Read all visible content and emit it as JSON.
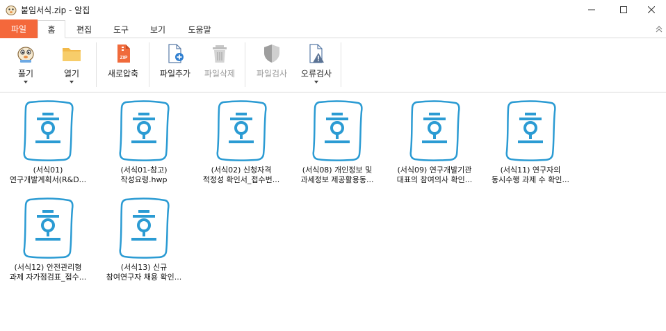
{
  "window": {
    "title": "붙임서식.zip - 알집",
    "app_icon": "alzip-mascot-icon",
    "controls": [
      "minimize-icon",
      "maximize-icon",
      "close-icon"
    ]
  },
  "menu": {
    "tabs": [
      "파일",
      "홈",
      "편집",
      "도구",
      "보기",
      "도움말"
    ],
    "active": "홈",
    "file_tab_color": "#f4683b"
  },
  "ribbon": {
    "buttons": [
      {
        "label": "풀기",
        "icon": "extract-mascot-icon",
        "has_dropdown": true,
        "enabled": true
      },
      {
        "label": "열기",
        "icon": "folder-icon",
        "has_dropdown": true,
        "enabled": true
      },
      {
        "label": "새로압축",
        "icon": "zip-file-icon",
        "has_dropdown": false,
        "enabled": true
      },
      {
        "label": "파일추가",
        "icon": "add-file-icon",
        "has_dropdown": false,
        "enabled": true
      },
      {
        "label": "파일삭제",
        "icon": "trash-icon",
        "has_dropdown": false,
        "enabled": false
      },
      {
        "label": "파일검사",
        "icon": "shield-icon",
        "has_dropdown": false,
        "enabled": false
      },
      {
        "label": "오류검사",
        "icon": "warning-file-icon",
        "has_dropdown": true,
        "enabled": true
      }
    ]
  },
  "files": [
    {
      "line1": "(서식01)",
      "line2": "연구개발계획서(R&D...",
      "icon": "hwp-document-icon"
    },
    {
      "line1": "(서식01-참고)",
      "line2": "작성요령.hwp",
      "icon": "hwp-document-icon"
    },
    {
      "line1": "(서식02) 신청자격",
      "line2": "적정성 확인서_접수번...",
      "icon": "hwp-document-icon"
    },
    {
      "line1": "(서식08) 개인정보 및",
      "line2": "과세정보 제공활용동...",
      "icon": "hwp-document-icon"
    },
    {
      "line1": "(서식09) 연구개발기관",
      "line2": "대표의 참여의사 확인...",
      "icon": "hwp-document-icon"
    },
    {
      "line1": "(서식11) 연구자의",
      "line2": "동시수행 과제 수 확인...",
      "icon": "hwp-document-icon"
    },
    {
      "line1": "(서식12) 안전관리형",
      "line2": "과제 자가점검표_접수...",
      "icon": "hwp-document-icon"
    },
    {
      "line1": "(서식13) 신규",
      "line2": "참여연구자 채용 확인...",
      "icon": "hwp-document-icon"
    }
  ],
  "colors": {
    "hwp_blue": "#2b9bd3",
    "accent_orange": "#f4683b"
  }
}
